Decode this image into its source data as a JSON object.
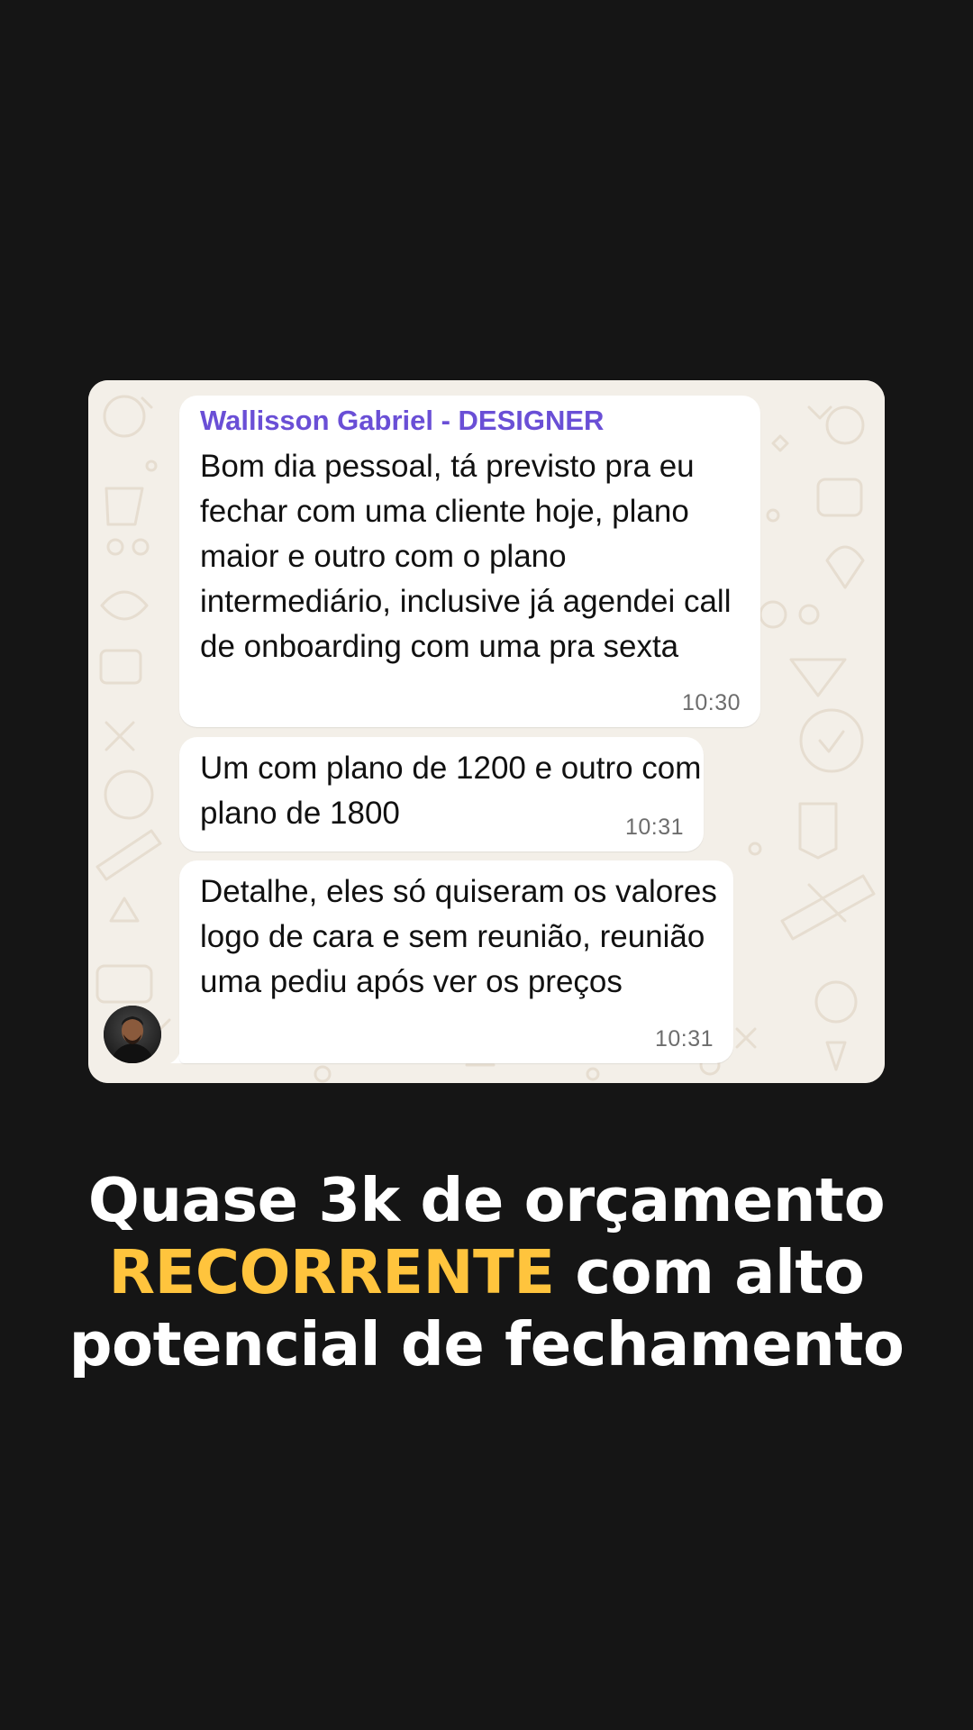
{
  "chat": {
    "messages": [
      {
        "sender": "Wallisson Gabriel - DESIGNER",
        "text": "Bom dia pessoal, tá previsto pra eu fechar com uma cliente hoje, plano maior e outro com o plano intermediário, inclusive já agendei call de onboarding com uma pra sexta",
        "time": "10:30"
      },
      {
        "text": "Um com plano de 1200 e outro com plano de 1800",
        "time": "10:31"
      },
      {
        "text": "Detalhe, eles só quiseram os valores logo de cara e sem reunião, reunião uma pediu após ver os preços",
        "time": "10:31"
      }
    ],
    "avatar_icon": "person-avatar"
  },
  "headline": {
    "line1": "Quase 3k de orçamento",
    "line2_accent": "RECORRENTE",
    "line2_rest": " com alto",
    "line3": "potencial de fechamento"
  },
  "colors": {
    "background": "#151515",
    "chat_wallpaper": "#f3efe8",
    "sender_name": "#6a4fd6",
    "accent": "#ffc43d",
    "headline": "#ffffff"
  }
}
